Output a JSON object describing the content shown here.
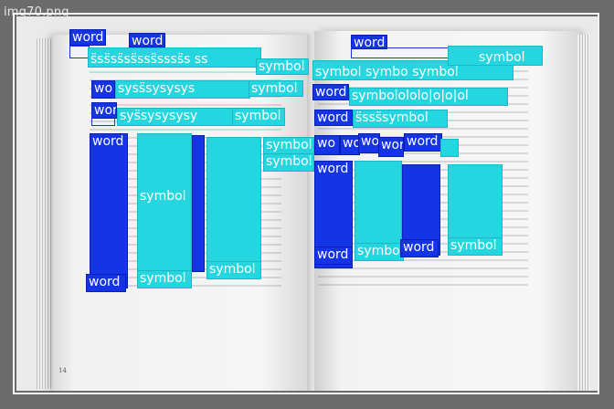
{
  "viewer": {
    "filename": "img70.png"
  },
  "book": {
    "left_page_number": "14",
    "right_page_number": ""
  },
  "detections": {
    "word_label": "word",
    "symbol_label": "symbol",
    "colors": {
      "word": "#1434e6",
      "symbol": "#25d6e0"
    },
    "strings": {
      "row1_left": "s̈ss̈ss̈ss̈sss̈ssss̈s ss",
      "row1_right": "symbol symbo symbol",
      "row2_left": "syss̈sysysys",
      "row2_right": "symbolololo|o|o|ol",
      "row3_left": "sys̈sysysysy",
      "row3_right": "s̈sss̈symbol",
      "wo": "wo",
      "wor": "wor"
    }
  }
}
